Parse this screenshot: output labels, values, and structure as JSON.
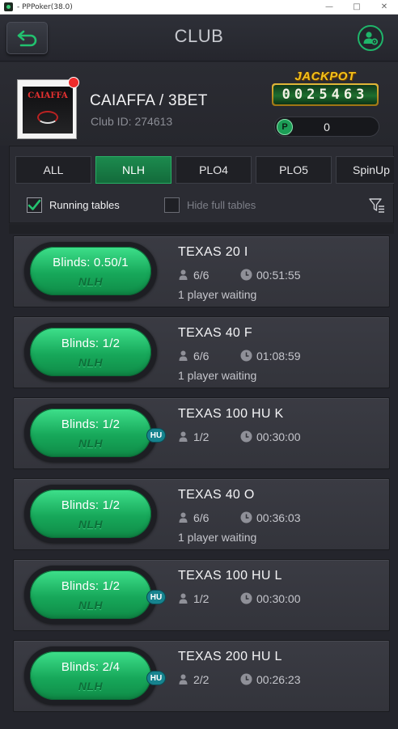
{
  "window": {
    "title": "- PPPoker(38.0)",
    "minimize": "—",
    "maximize": "□",
    "close": "✕"
  },
  "header": {
    "title": "CLUB",
    "back_icon": "back-arrow-icon",
    "settings_icon": "user-gear-icon"
  },
  "club": {
    "name": "CAIAFFA / 3BET",
    "id_text": "Club ID: 274613",
    "logo_text": "CAIAFFA",
    "jackpot_label": "JACKPOT",
    "jackpot_value": "0025463",
    "points_icon": "P",
    "points_value": "0"
  },
  "tabs": [
    {
      "label": "ALL",
      "active": false
    },
    {
      "label": "NLH",
      "active": true
    },
    {
      "label": "PLO4",
      "active": false
    },
    {
      "label": "PLO5",
      "active": false
    },
    {
      "label": "SpinUp",
      "active": false
    }
  ],
  "filters": {
    "running_label": "Running tables",
    "running_checked": true,
    "hide_full_label": "Hide full tables",
    "hide_full_checked": false
  },
  "colors": {
    "accent_green": "#1fb56a",
    "hu_badge": "#16838e",
    "background": "#24252c"
  },
  "tables": [
    {
      "blinds": "Blinds: 0.50/1",
      "game": "NLH",
      "hu": false,
      "name": "TEXAS 20 I",
      "seats": "6/6",
      "time": "00:51:55",
      "waiting": "1 player waiting"
    },
    {
      "blinds": "Blinds: 1/2",
      "game": "NLH",
      "hu": false,
      "name": "TEXAS 40 F",
      "seats": "6/6",
      "time": "01:08:59",
      "waiting": "1 player waiting"
    },
    {
      "blinds": "Blinds: 1/2",
      "game": "NLH",
      "hu": true,
      "hu_label": "HU",
      "name": "TEXAS 100 HU K",
      "seats": "1/2",
      "time": "00:30:00",
      "waiting": ""
    },
    {
      "blinds": "Blinds: 1/2",
      "game": "NLH",
      "hu": false,
      "name": "TEXAS 40 O",
      "seats": "6/6",
      "time": "00:36:03",
      "waiting": "1 player waiting"
    },
    {
      "blinds": "Blinds: 1/2",
      "game": "NLH",
      "hu": true,
      "hu_label": "HU",
      "name": "TEXAS 100 HU L",
      "seats": "1/2",
      "time": "00:30:00",
      "waiting": ""
    },
    {
      "blinds": "Blinds: 2/4",
      "game": "NLH",
      "hu": true,
      "hu_label": "HU",
      "name": "TEXAS 200 HU L",
      "seats": "2/2",
      "time": "00:26:23",
      "waiting": ""
    }
  ]
}
